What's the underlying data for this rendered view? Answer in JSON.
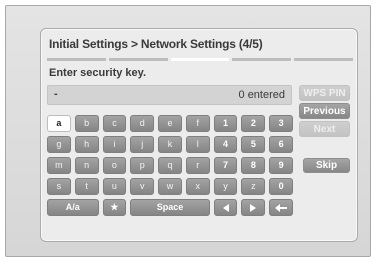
{
  "header": {
    "title": "Initial Settings > Network Settings (4/5)"
  },
  "progress": {
    "total_steps": 5,
    "active_step": 3
  },
  "prompt": "Enter security key.",
  "input": {
    "value": "-",
    "count_text": "0 entered"
  },
  "side_buttons": {
    "wps_pin": "WPS PIN",
    "previous": "Previous",
    "next": "Next",
    "skip": "Skip"
  },
  "keyboard": {
    "rows": [
      [
        "a",
        "b",
        "c",
        "d",
        "e",
        "f",
        "1",
        "2",
        "3"
      ],
      [
        "g",
        "h",
        "i",
        "j",
        "k",
        "l",
        "4",
        "5",
        "6"
      ],
      [
        "m",
        "n",
        "o",
        "p",
        "q",
        "r",
        "7",
        "8",
        "9"
      ],
      [
        "s",
        "t",
        "u",
        "v",
        "w",
        "x",
        "y",
        "z",
        "0"
      ]
    ],
    "bottom": {
      "case_toggle": "A/a",
      "star": "★",
      "space": "Space"
    }
  },
  "colors": {
    "selected_key": "#ffffff",
    "key": "#959595",
    "panel": "#ececec"
  }
}
